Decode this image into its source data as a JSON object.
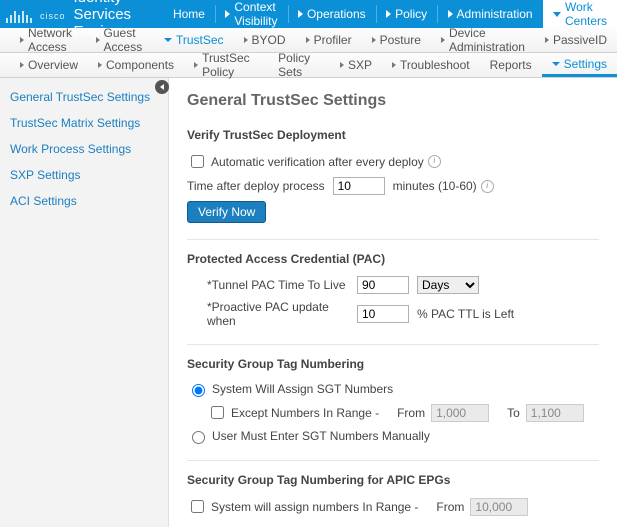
{
  "branding": {
    "company": "cisco",
    "product": "Identity Services Engine"
  },
  "topnav": {
    "home": "Home",
    "context": "Context Visibility",
    "operations": "Operations",
    "policy": "Policy",
    "administration": "Administration",
    "workcenters": "Work Centers"
  },
  "subnav1": {
    "netaccess": "Network Access",
    "guest": "Guest Access",
    "trustsec": "TrustSec",
    "byod": "BYOD",
    "profiler": "Profiler",
    "posture": "Posture",
    "device": "Device Administration",
    "passiveid": "PassiveID"
  },
  "subnav2": {
    "overview": "Overview",
    "components": "Components",
    "tspolicy": "TrustSec Policy",
    "policysets": "Policy Sets",
    "sxp": "SXP",
    "troubleshoot": "Troubleshoot",
    "reports": "Reports",
    "settings": "Settings"
  },
  "leftnav": {
    "general": "General TrustSec Settings",
    "matrix": "TrustSec Matrix Settings",
    "workprocess": "Work Process Settings",
    "sxp": "SXP Settings",
    "aci": "ACI Settings"
  },
  "page": {
    "title": "General TrustSec Settings",
    "sec_verify": {
      "title": "Verify TrustSec Deployment",
      "auto_chk": "Automatic verification after every deploy",
      "time_label": "Time after deploy process",
      "time_value": "10",
      "time_suffix": "minutes (10-60)",
      "verify_btn": "Verify Now"
    },
    "sec_pac": {
      "title": "Protected Access Credential (PAC)",
      "ttl_label": "*Tunnel PAC Time To Live",
      "ttl_value": "90",
      "ttl_unit": "Days",
      "proactive_label": "*Proactive PAC update when",
      "proactive_value": "10",
      "proactive_suffix": "% PAC TTL is Left"
    },
    "sec_sgt": {
      "title": "Security Group Tag Numbering",
      "opt1": "System Will Assign SGT Numbers",
      "except_chk": "Except Numbers In Range -",
      "from_label": "From",
      "from_val": "1,000",
      "to_label": "To",
      "to_val": "1,100",
      "opt2": "User Must Enter SGT Numbers Manually"
    },
    "sec_apic": {
      "title": "Security Group Tag Numbering for APIC EPGs",
      "chk": "System will assign numbers In Range -",
      "from_label": "From",
      "from_val": "10,000"
    }
  }
}
